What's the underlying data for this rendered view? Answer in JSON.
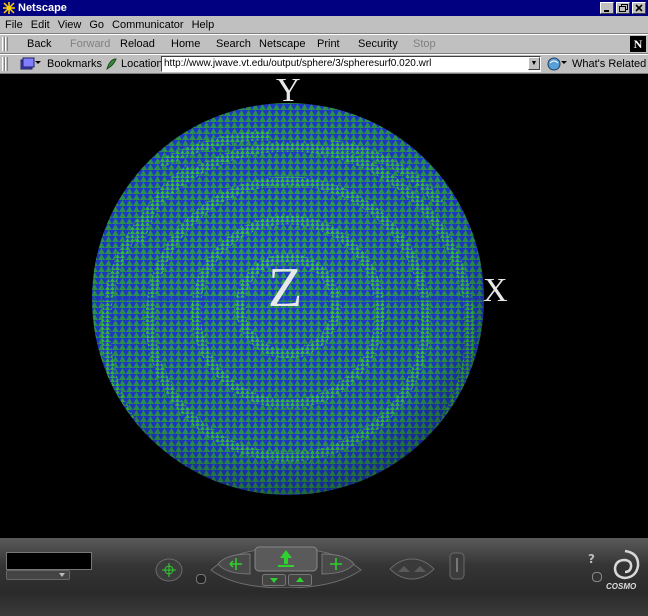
{
  "window": {
    "title": "Netscape",
    "controls": [
      "minimize",
      "maximize",
      "close"
    ]
  },
  "menu": {
    "items": [
      "File",
      "Edit",
      "View",
      "Go",
      "Communicator",
      "Help"
    ]
  },
  "navigation": {
    "buttons": [
      {
        "label": "Back",
        "enabled": true
      },
      {
        "label": "Forward",
        "enabled": false
      },
      {
        "label": "Reload",
        "enabled": true
      },
      {
        "label": "Home",
        "enabled": true
      },
      {
        "label": "Search",
        "enabled": true
      },
      {
        "label": "Netscape",
        "enabled": true
      },
      {
        "label": "Print",
        "enabled": true
      },
      {
        "label": "Security",
        "enabled": true
      },
      {
        "label": "Stop",
        "enabled": false
      }
    ],
    "logo_letter": "N"
  },
  "location_bar": {
    "bookmarks_label": "Bookmarks",
    "location_label": "Location:",
    "url": "http://www.jwave.vt.edu/output/sphere/3/spheresurf0.020.wrl",
    "whats_related_label": "What's Related"
  },
  "viewport": {
    "background": "#000000",
    "sphere_colors": {
      "primary": "#2a9a5a",
      "secondary": "#1f3bd0",
      "highlight": "#3ad83a"
    },
    "axis_labels": {
      "y": "Y",
      "z": "Z",
      "x": "X"
    }
  },
  "cosmo_dashboard": {
    "brand_text": "COSMO",
    "help_glyph": "?",
    "accent_color": "#2ed12e"
  }
}
